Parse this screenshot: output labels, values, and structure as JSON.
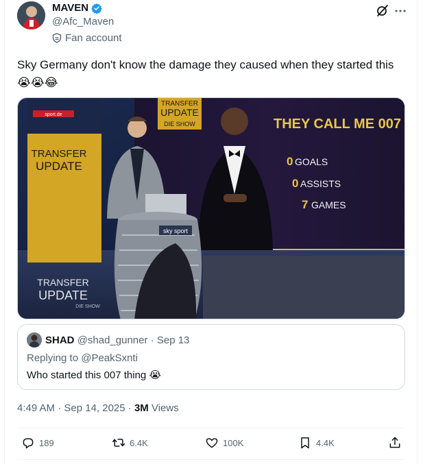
{
  "author": {
    "display_name": "MAVEN",
    "handle": "@Afc_Maven",
    "label": "Fan account"
  },
  "tweet": {
    "text": "Sky Germany don't know the damage they caused when they started this",
    "emojis": "😭😭😂"
  },
  "media": {
    "sport_tag": "sport.de",
    "left_panel": [
      "TRANSFER",
      "UPDATE"
    ],
    "show_logo": [
      "TRANSFER",
      "UPDATE",
      "DIE SHOW"
    ],
    "headline": "THEY CALL ME 007",
    "stats": [
      {
        "number": "0",
        "label": "GOALS"
      },
      {
        "number": "0",
        "label": "ASSISTS"
      },
      {
        "number": "7",
        "label": "GAMES"
      }
    ],
    "desk_logo": "sky sport",
    "bottom_logo": [
      "TRANSFER",
      "UPDATE",
      "DIE SHOW"
    ]
  },
  "quote": {
    "display_name": "SHAD",
    "handle": "@shad_gunner",
    "date": "Sep 13",
    "replying_to": "Replying to @PeakSxnti",
    "text": "Who started this 007 thing",
    "emoji": "😭"
  },
  "meta": {
    "time_date": "4:49 AM · Sep 14, 2025 · ",
    "views_count": "3M",
    "views_label": " Views"
  },
  "actions": {
    "replies": "189",
    "reposts": "6.4K",
    "likes": "100K",
    "bookmarks": "4.4K"
  },
  "colors": {
    "text": "#0f1419",
    "secondary": "#536471",
    "verified": "#1d9bf0",
    "border": "#cfd9de"
  }
}
